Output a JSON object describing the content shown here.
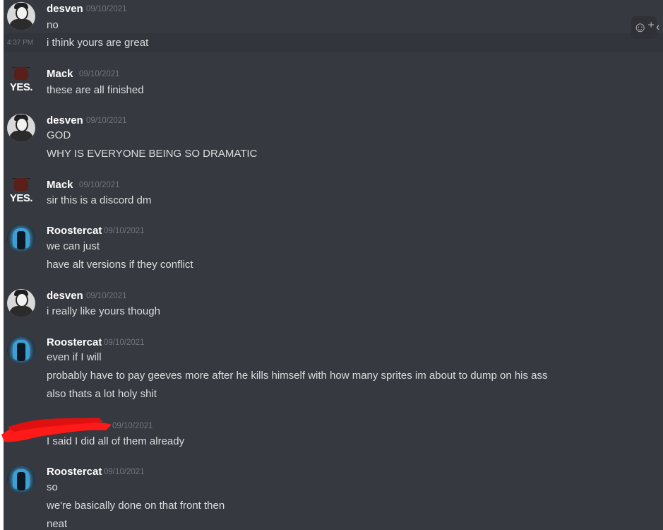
{
  "chat": {
    "groups": [
      {
        "author": "desven",
        "timestamp": "09/10/2021",
        "lines": [
          "no"
        ]
      },
      {
        "hover_time": "4:37 PM",
        "lines": [
          "i think yours are great"
        ]
      },
      {
        "author": "Mack",
        "timestamp": "09/10/2021",
        "lines": [
          "these are all finished"
        ]
      },
      {
        "author": "desven",
        "timestamp": "09/10/2021",
        "lines": [
          "GOD",
          "WHY IS EVERYONE BEING SO DRAMATIC"
        ]
      },
      {
        "author": "Mack",
        "timestamp": "09/10/2021",
        "lines": [
          "sir this is a discord dm"
        ]
      },
      {
        "author": "Roostercat",
        "timestamp": "09/10/2021",
        "lines": [
          "we can just",
          "have alt versions if they conflict"
        ]
      },
      {
        "author": "desven",
        "timestamp": "09/10/2021",
        "lines": [
          "i really like yours though"
        ]
      },
      {
        "author": "Roostercat",
        "timestamp": "09/10/2021",
        "lines": [
          "even if I will",
          "probably have to pay geeves more after he kills himself with how many sprites im about to dump on his ass",
          "also thats a lot holy shit"
        ]
      },
      {
        "author": "",
        "timestamp": "09/10/2021",
        "lines": [
          "I said I did all of them already"
        ]
      },
      {
        "author": "Roostercat",
        "timestamp": "09/10/2021",
        "lines": [
          "so",
          "we're basically done on that front then",
          "neat"
        ]
      }
    ]
  },
  "avatars": {
    "mack_badge": "YES."
  },
  "actions": {
    "add_reaction_icon": "emoji-plus-icon",
    "add_reaction": "☺⁺",
    "more": "‹"
  },
  "colors": {
    "background": "#36393f",
    "username": "#ffffff",
    "message": "#dcddde",
    "timestamp": "#72767d",
    "redaction": "#ff1a1a"
  }
}
